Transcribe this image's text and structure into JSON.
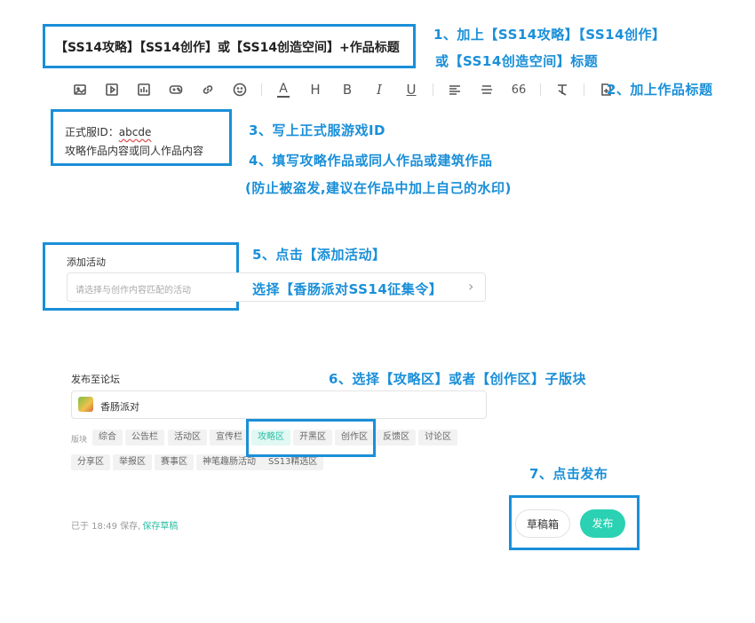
{
  "title": {
    "value": "【SS14攻略】【SS14创作】或【SS14创造空间】+作品标题",
    "annotation_line1": "1、加上【SS14攻略】【SS14创作】",
    "annotation_line2": "或【SS14创造空间】标题"
  },
  "toolbar": {
    "icons": [
      "image-icon",
      "video-icon",
      "chart-icon",
      "gamepad-icon",
      "link-icon",
      "emoji-icon",
      "font-color-icon",
      "heading-icon",
      "bold-icon",
      "italic-icon",
      "underline-icon",
      "align-icon",
      "divider-icon",
      "quote-icon",
      "clear-format-icon",
      "add-title-icon"
    ],
    "heading_glyph": "H",
    "bold_glyph": "B",
    "italic_glyph": "I",
    "underline_glyph": "U",
    "quote_glyph": "66",
    "font_color_glyph": "A",
    "annotation": "2、加上作品标题"
  },
  "content": {
    "id_line_prefix": "正式服ID：",
    "id_value": "abcde",
    "body_line": "攻略作品内容或同人作品内容",
    "annotation_id": "3、写上正式服游戏ID",
    "annotation_fill": "4、填写攻略作品或同人作品或建筑作品",
    "annotation_watermark": "(防止被盗发,建议在作品中加上自己的水印)"
  },
  "activity": {
    "label": "添加活动",
    "placeholder": "请选择与创作内容匹配的活动",
    "annotation_click": "5、点击【添加活动】",
    "annotation_select": "选择【香肠派对SS14征集令】",
    "chevron": "›"
  },
  "forum": {
    "label": "发布至论坛",
    "selected_forum": "香肠派对",
    "section_label": "版块",
    "sections_row1": [
      "综合",
      "公告栏",
      "活动区",
      "宣传栏",
      "攻略区",
      "开黑区",
      "创作区",
      "反馈区",
      "讨论区"
    ],
    "sections_row2": [
      "分享区",
      "举报区",
      "赛事区",
      "神笔趣肠活动",
      "SS13精选区"
    ],
    "annotation": "6、选择【攻略区】或者【创作区】子版块"
  },
  "footer": {
    "saved_text": "已于 18:49 保存,",
    "save_draft_link": "保存草稿",
    "draft_box_button": "草稿箱",
    "publish_button": "发布",
    "annotation": "7、点击发布"
  },
  "colors": {
    "annotation_blue": "#1a8fd8",
    "accent_teal": "#2bd1b3",
    "active_chip_bg": "#e2f8f3"
  }
}
